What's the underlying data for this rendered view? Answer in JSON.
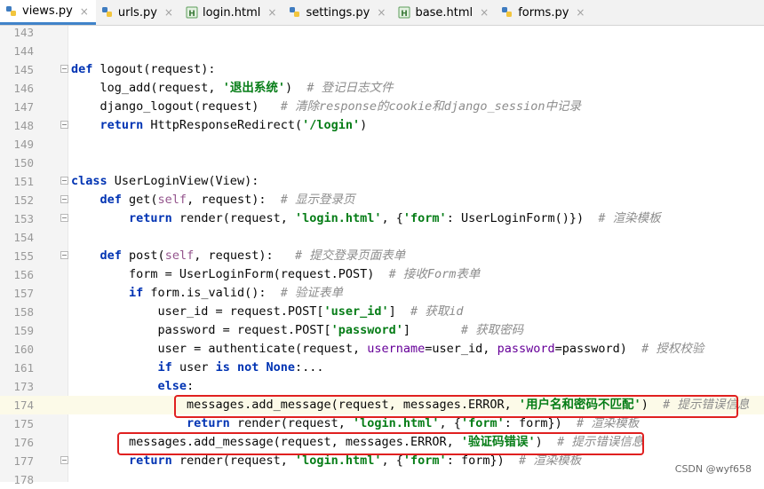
{
  "tabs": [
    {
      "label": "views.py",
      "icon": "python-file-icon",
      "active": true
    },
    {
      "label": "urls.py",
      "icon": "python-file-icon",
      "active": false
    },
    {
      "label": "login.html",
      "icon": "html-file-icon",
      "active": false
    },
    {
      "label": "settings.py",
      "icon": "python-file-icon",
      "active": false
    },
    {
      "label": "base.html",
      "icon": "html-file-icon",
      "active": false
    },
    {
      "label": "forms.py",
      "icon": "python-file-icon",
      "active": false
    }
  ],
  "close_glyph": "×",
  "lines": [
    {
      "num": "143",
      "code": ""
    },
    {
      "num": "144",
      "code": ""
    },
    {
      "num": "145",
      "code": "def logout(request):"
    },
    {
      "num": "146",
      "code": "    log_add(request, '退出系统')  # 登记日志文件"
    },
    {
      "num": "147",
      "code": "    django_logout(request)   # 清除response的cookie和django_session中记录"
    },
    {
      "num": "148",
      "code": "    return HttpResponseRedirect('/login')"
    },
    {
      "num": "149",
      "code": ""
    },
    {
      "num": "150",
      "code": ""
    },
    {
      "num": "151",
      "code": "class UserLoginView(View):"
    },
    {
      "num": "152",
      "code": "    def get(self, request):  # 显示登录页"
    },
    {
      "num": "153",
      "code": "        return render(request, 'login.html', {'form': UserLoginForm()})  # 渲染模板"
    },
    {
      "num": "154",
      "code": ""
    },
    {
      "num": "155",
      "code": "    def post(self, request):   # 提交登录页面表单"
    },
    {
      "num": "156",
      "code": "        form = UserLoginForm(request.POST)  # 接收Form表单"
    },
    {
      "num": "157",
      "code": "        if form.is_valid():  # 验证表单"
    },
    {
      "num": "158",
      "code": "            user_id = request.POST['user_id']  # 获取id"
    },
    {
      "num": "159",
      "code": "            password = request.POST['password']       # 获取密码"
    },
    {
      "num": "160",
      "code": "            user = authenticate(request, username=user_id, password=password)  # 授权校验"
    },
    {
      "num": "161",
      "code": "            if user is not None:..."
    },
    {
      "num": "173",
      "code": "            else:"
    },
    {
      "num": "174",
      "code": "                messages.add_message(request, messages.ERROR, '用户名和密码不匹配')  # 提示错误信息"
    },
    {
      "num": "175",
      "code": "                return render(request, 'login.html', {'form': form})  # 渲染模板"
    },
    {
      "num": "176",
      "code": "        messages.add_message(request, messages.ERROR, '验证码错误')  # 提示错误信息"
    },
    {
      "num": "177",
      "code": "        return render(request, 'login.html', {'form': form})  # 渲染模板"
    },
    {
      "num": "178",
      "code": ""
    }
  ],
  "watermark": "CSDN @wyf658"
}
